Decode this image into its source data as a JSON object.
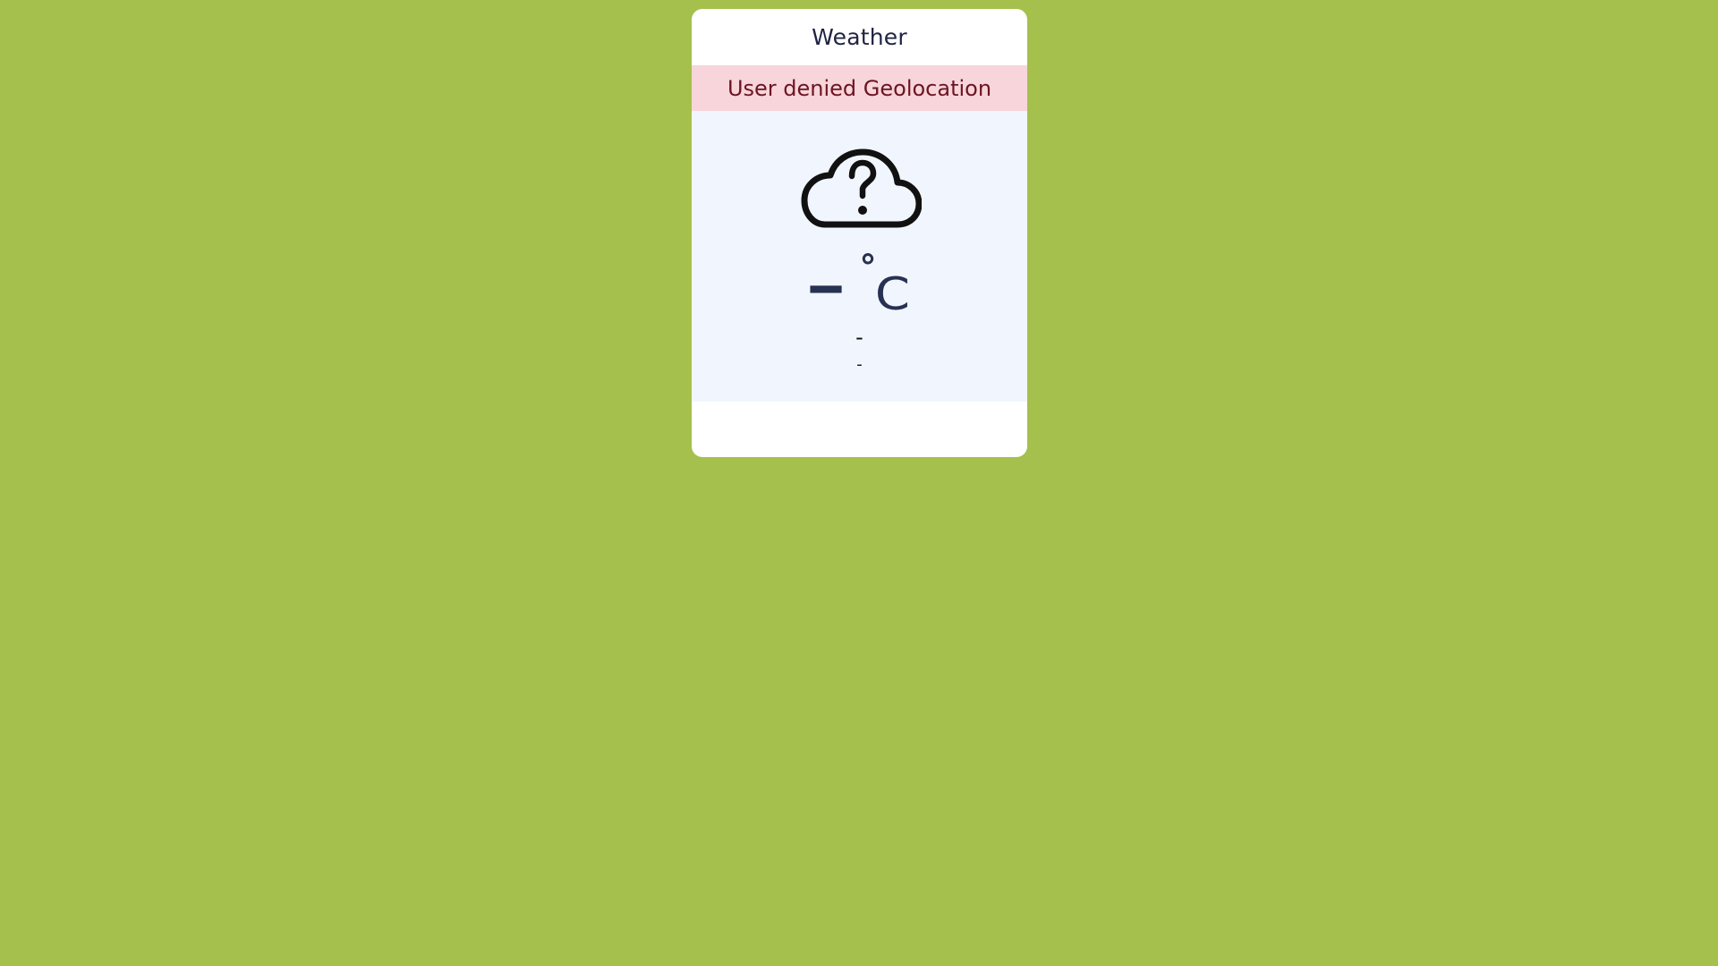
{
  "widget": {
    "title": "Weather",
    "alert_message": "User denied Geolocation",
    "icon": "cloud-question-icon",
    "temperature": {
      "value": "–",
      "degree_symbol": "°",
      "unit": "C"
    },
    "condition": "-",
    "location": "-"
  },
  "colors": {
    "page_background": "#a5c04c",
    "card_background": "#ffffff",
    "alert_background": "#f7d5da",
    "alert_text": "#6d1422",
    "content_background": "#f1f6fe",
    "temperature_text": "#273152"
  }
}
